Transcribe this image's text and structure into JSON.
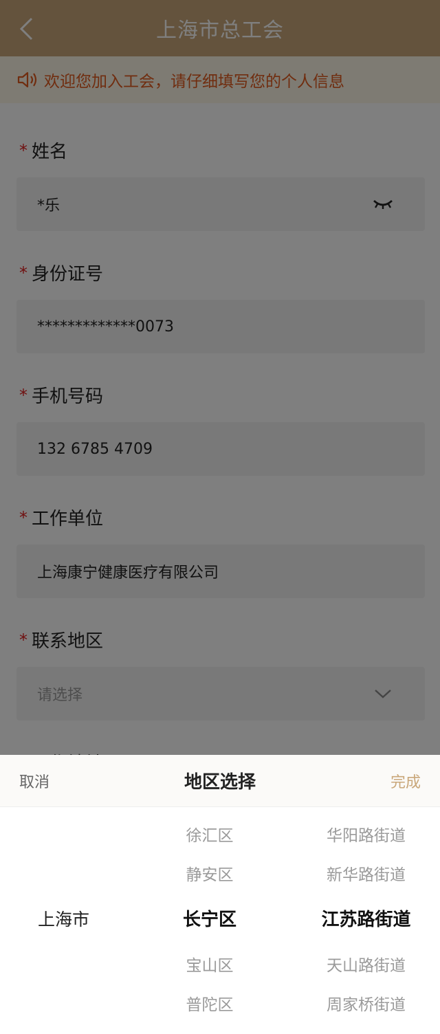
{
  "header": {
    "title": "上海市总工会"
  },
  "notice": {
    "text": "欢迎您加入工会，请仔细填写您的个人信息"
  },
  "form": {
    "name": {
      "label": "姓名",
      "value": "*乐"
    },
    "id_number": {
      "label": "身份证号",
      "value": "*************0073"
    },
    "phone": {
      "label": "手机号码",
      "value": "132 6785 4709"
    },
    "employer": {
      "label": "工作单位",
      "value": "上海康宁健康医疗有限公司"
    },
    "region": {
      "label": "联系地区",
      "placeholder": "请选择"
    },
    "work_address": {
      "label": "工作地址"
    }
  },
  "picker": {
    "cancel": "取消",
    "title": "地区选择",
    "done": "完成",
    "cities": [
      "上海市"
    ],
    "districts": [
      "徐汇区",
      "静安区",
      "长宁区",
      "宝山区",
      "普陀区"
    ],
    "streets": [
      "华阳路街道",
      "新华路街道",
      "江苏路街道",
      "天山路街道",
      "周家桥街道"
    ]
  },
  "colors": {
    "header_bg": "#c9a77a",
    "notice_text": "#e05a1f",
    "required": "#e02020",
    "done_text": "#c9a77a"
  }
}
